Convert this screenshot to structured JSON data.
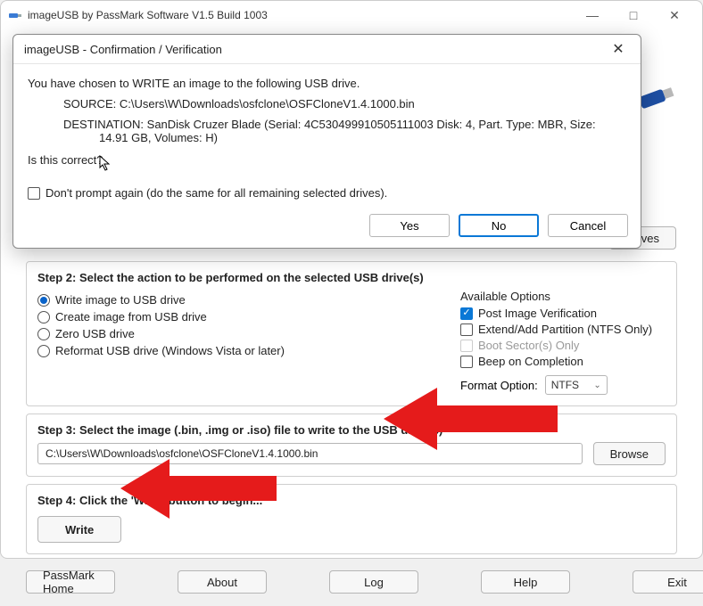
{
  "window": {
    "title": "imageUSB by PassMark Software V1.5 Build 1003"
  },
  "modal": {
    "title": "imageUSB - Confirmation / Verification",
    "line1": "You have chosen to WRITE an image to the following USB drive.",
    "source": "SOURCE: C:\\Users\\W\\Downloads\\osfclone\\OSFCloneV1.4.1000.bin",
    "destination": "DESTINATION: SanDisk Cruzer Blade (Serial: 4C530499910505111003 Disk: 4, Part. Type: MBR, Size: 14.91 GB, Volumes: H)",
    "confirm": "Is this correct?",
    "dont_prompt": "Don't prompt again (do the same for all remaining selected drives).",
    "yes": "Yes",
    "no": "No",
    "cancel": "Cancel"
  },
  "drives_btn": "Drives",
  "step2": {
    "title": "Step 2: Select the action to be performed on the selected USB drive(s)",
    "r1": "Write image to USB drive",
    "r2": "Create image from USB drive",
    "r3": "Zero USB drive",
    "r4": "Reformat USB drive (Windows Vista or later)",
    "avail_title": "Available Options",
    "c1": "Post Image Verification",
    "c2": "Extend/Add Partition (NTFS Only)",
    "c3": "Boot Sector(s) Only",
    "c4": "Beep on Completion",
    "format_label": "Format Option:",
    "format_value": "NTFS"
  },
  "step3": {
    "title": "Step 3: Select the image (.bin, .img or .iso) file to write to the USB drive(s)",
    "path": "C:\\Users\\W\\Downloads\\osfclone\\OSFCloneV1.4.1000.bin",
    "browse": "Browse"
  },
  "step4": {
    "title": "Step 4: Click the 'Write' button to begin...",
    "write": "Write"
  },
  "bottom": {
    "b1": "PassMark Home",
    "b2": "About",
    "b3": "Log",
    "b4": "Help",
    "b5": "Exit"
  }
}
